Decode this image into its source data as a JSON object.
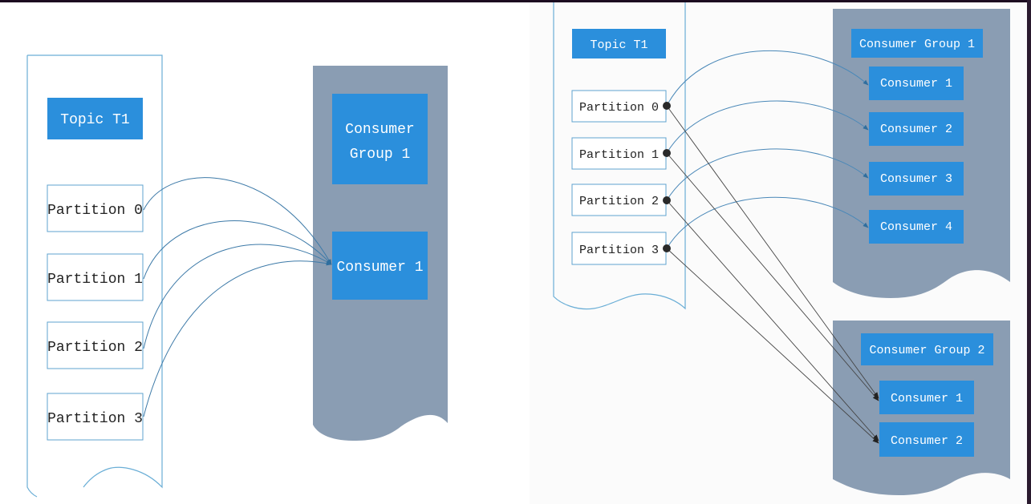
{
  "colors": {
    "box_blue": "#2b8fdc",
    "group_gray": "#8a9db3",
    "outline_blue": "#6aaed6",
    "arrow_blue": "#3d7aa8",
    "arrow_dark": "#333333"
  },
  "left_diagram": {
    "topic": "Topic T1",
    "partitions": [
      "Partition 0",
      "Partition 1",
      "Partition 2",
      "Partition 3"
    ],
    "group": {
      "line1": "Consumer",
      "line2": "Group 1"
    },
    "consumer": "Consumer 1",
    "connections": [
      {
        "from": "Partition 0",
        "to": "Consumer 1"
      },
      {
        "from": "Partition 1",
        "to": "Consumer 1"
      },
      {
        "from": "Partition 2",
        "to": "Consumer 1"
      },
      {
        "from": "Partition 3",
        "to": "Consumer 1"
      }
    ]
  },
  "right_diagram": {
    "topic": "Topic T1",
    "partitions": [
      "Partition 0",
      "Partition 1",
      "Partition 2",
      "Partition 3"
    ],
    "group1": {
      "title": "Consumer Group 1",
      "consumers": [
        "Consumer 1",
        "Consumer 2",
        "Consumer 3",
        "Consumer 4"
      ]
    },
    "group2": {
      "title": "Consumer Group 2",
      "consumers": [
        "Consumer 1",
        "Consumer 2"
      ]
    },
    "connections_group1": [
      {
        "from": "Partition 0",
        "to": "Consumer 1"
      },
      {
        "from": "Partition 1",
        "to": "Consumer 2"
      },
      {
        "from": "Partition 2",
        "to": "Consumer 3"
      },
      {
        "from": "Partition 3",
        "to": "Consumer 4"
      }
    ],
    "connections_group2": [
      {
        "from": "Partition 0",
        "to": "Consumer 1"
      },
      {
        "from": "Partition 1",
        "to": "Consumer 1"
      },
      {
        "from": "Partition 2",
        "to": "Consumer 2"
      },
      {
        "from": "Partition 3",
        "to": "Consumer 2"
      }
    ]
  }
}
